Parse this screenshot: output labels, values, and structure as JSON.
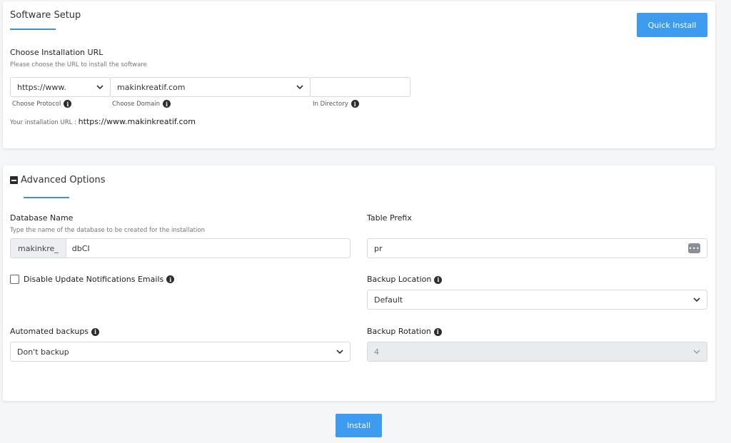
{
  "setup": {
    "title": "Software Setup",
    "quick_install": "Quick Install",
    "url_heading": "Choose Installation URL",
    "url_hint": "Please choose the URL to install the software",
    "protocol_value": "https://www.",
    "domain_value": "makinkreatif.com",
    "directory_value": "",
    "protocol_label": "Choose Protocol",
    "domain_label": "Choose Domain",
    "directory_label": "In Directory",
    "install_url_label": "Your installation URL :",
    "install_url_value": "https://www.makinkreatif.com"
  },
  "advanced": {
    "title": "Advanced Options",
    "db_name_label": "Database Name",
    "db_name_hint": "Type the name of the database to be created for the installation",
    "db_prefix": "makinkre_",
    "db_value": "dbCI",
    "table_prefix_label": "Table Prefix",
    "table_prefix_value": "pr",
    "disable_notif_label": "Disable Update Notifications Emails",
    "backup_location_label": "Backup Location",
    "backup_location_value": "Default",
    "auto_backups_label": "Automated backups",
    "auto_backups_value": "Don't backup",
    "backup_rotation_label": "Backup Rotation",
    "backup_rotation_value": "4"
  },
  "install_button": "Install",
  "colors": {
    "accent": "#3d9bf0",
    "underline": "#3d8fe0"
  }
}
